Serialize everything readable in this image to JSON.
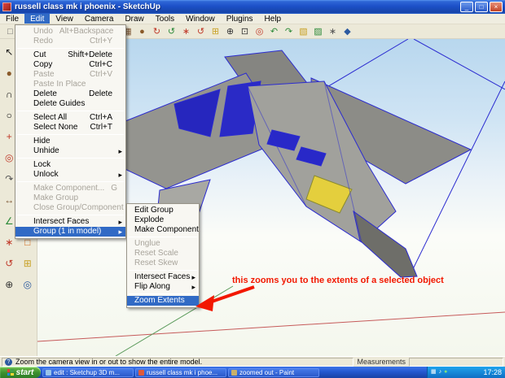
{
  "colors": {
    "accent": "#316AC5",
    "annotation_red": "#F21800",
    "selection_blue": "#2B2BD0",
    "canopy_yellow": "#E4CF3D",
    "axis_red": "#C65A5A",
    "axis_green": "#5A9A5A",
    "taskbar_blue": "#2458D0",
    "start_green": "#3B8F2E"
  },
  "window": {
    "title": "russell class mk i phoenix - SketchUp",
    "controls": [
      {
        "name": "minimize-button",
        "glyph": "_"
      },
      {
        "name": "maximize-button",
        "glyph": "□"
      },
      {
        "name": "close-button",
        "glyph": "×",
        "cls": "close"
      }
    ]
  },
  "menu_bar": {
    "items": [
      {
        "label": "File"
      },
      {
        "label": "Edit",
        "active": true
      },
      {
        "label": "View"
      },
      {
        "label": "Camera"
      },
      {
        "label": "Draw"
      },
      {
        "label": "Tools"
      },
      {
        "label": "Window"
      },
      {
        "label": "Plugins"
      },
      {
        "label": "Help"
      }
    ]
  },
  "top_toolbar": {
    "icons": [
      {
        "name": "new-icon",
        "glyph": "□",
        "color": "#666666"
      },
      {
        "name": "open-icon",
        "glyph": "▤",
        "color": "#C9A227"
      },
      {
        "name": "save-icon",
        "glyph": "▣",
        "color": "#2C5AA0"
      },
      {
        "name": "cut-icon",
        "glyph": "×",
        "color": "#555555"
      },
      {
        "name": "copy-icon",
        "glyph": "▥",
        "color": "#555555"
      },
      {
        "name": "paste-icon",
        "glyph": "▧",
        "color": "#777777"
      },
      {
        "name": "undo-icon",
        "glyph": "↶",
        "color": "#2C5AA0"
      },
      {
        "name": "redo-icon",
        "glyph": "↷",
        "color": "#2C5AA0"
      },
      {
        "name": "make-component-icon",
        "glyph": "▦",
        "color": "#7A5230"
      },
      {
        "name": "paint-bucket-icon",
        "glyph": "●",
        "color": "#8A5A2A"
      },
      {
        "name": "rotate-cw-icon",
        "glyph": "↻",
        "color": "#C03A2A"
      },
      {
        "name": "rotate-ccw-icon",
        "glyph": "↺",
        "color": "#2E8B3A"
      },
      {
        "name": "axes-tool-icon",
        "glyph": "∗",
        "color": "#C03A2A"
      },
      {
        "name": "orbit-icon",
        "glyph": "↺",
        "color": "#C03A2A"
      },
      {
        "name": "pan-icon",
        "glyph": "⊞",
        "color": "#C9A227"
      },
      {
        "name": "zoom-icon",
        "glyph": "⊕",
        "color": "#333333"
      },
      {
        "name": "zoom-window-icon",
        "glyph": "⊡",
        "color": "#333333"
      },
      {
        "name": "zoom-extents-icon",
        "glyph": "◎",
        "color": "#C03A2A"
      },
      {
        "name": "previous-view-icon",
        "glyph": "↶",
        "color": "#2E8B3A"
      },
      {
        "name": "next-view-icon",
        "glyph": "↷",
        "color": "#2E8B3A"
      },
      {
        "name": "plugin-box-icon",
        "glyph": "▧",
        "color": "#C9A227"
      },
      {
        "name": "plugin-box2-icon",
        "glyph": "▨",
        "color": "#2E8B3A"
      },
      {
        "name": "plugin-gear-icon",
        "glyph": "∗",
        "color": "#555555"
      },
      {
        "name": "plugin-diamond-icon",
        "glyph": "◆",
        "color": "#2C5AA0"
      }
    ]
  },
  "left_toolbar": {
    "icons": [
      {
        "name": "select-icon",
        "glyph": "↖",
        "color": "#111111"
      },
      {
        "name": "eraser-icon",
        "glyph": "▬",
        "color": "#B0568A"
      },
      {
        "name": "paint-icon",
        "glyph": "●",
        "color": "#8A5A2A"
      },
      {
        "name": "line-icon",
        "glyph": "/",
        "color": "#111111"
      },
      {
        "name": "arc-icon",
        "glyph": "∩",
        "color": "#111111"
      },
      {
        "name": "rectangle-icon",
        "glyph": "□",
        "color": "#111111"
      },
      {
        "name": "circle-icon",
        "glyph": "○",
        "color": "#111111"
      },
      {
        "name": "polygon-icon",
        "glyph": "◇",
        "color": "#111111"
      },
      {
        "name": "move-icon",
        "glyph": "+",
        "color": "#C03A2A"
      },
      {
        "name": "rotate-icon",
        "glyph": "↻",
        "color": "#2C5AA0"
      },
      {
        "name": "offset-icon",
        "glyph": "◎",
        "color": "#C03A2A"
      },
      {
        "name": "push-pull-icon",
        "glyph": "↑",
        "color": "#7A5230"
      },
      {
        "name": "follow-me-icon",
        "glyph": "↷",
        "color": "#555555"
      },
      {
        "name": "scale-icon",
        "glyph": "▣",
        "color": "#C9A227"
      },
      {
        "name": "tape-measure-icon",
        "glyph": "↔",
        "color": "#7A5230"
      },
      {
        "name": "dimension-icon",
        "glyph": "⊢",
        "color": "#333333"
      },
      {
        "name": "protractor-icon",
        "glyph": "∠",
        "color": "#2E8B3A"
      },
      {
        "name": "text-icon",
        "glyph": "A",
        "color": "#111111"
      },
      {
        "name": "axes-icon",
        "glyph": "∗",
        "color": "#C03A2A"
      },
      {
        "name": "section-plane-icon",
        "glyph": "□",
        "color": "#D2691E"
      },
      {
        "name": "orbit-icon",
        "glyph": "↺",
        "color": "#C03A2A"
      },
      {
        "name": "pan-icon",
        "glyph": "⊞",
        "color": "#C9A227"
      },
      {
        "name": "zoom-icon",
        "glyph": "⊕",
        "color": "#333333"
      },
      {
        "name": "zoom-extents-icon",
        "glyph": "◎",
        "color": "#2C5AA0"
      }
    ]
  },
  "edit_menu": {
    "items": [
      {
        "label": "Undo",
        "shortcut": "Alt+Backspace",
        "disabled": true
      },
      {
        "label": "Redo",
        "shortcut": "Ctrl+Y",
        "disabled": true
      },
      {
        "separator": true
      },
      {
        "label": "Cut",
        "shortcut": "Shift+Delete"
      },
      {
        "label": "Copy",
        "shortcut": "Ctrl+C"
      },
      {
        "label": "Paste",
        "shortcut": "Ctrl+V",
        "disabled": true
      },
      {
        "label": "Paste In Place",
        "disabled": true
      },
      {
        "label": "Delete",
        "shortcut": "Delete"
      },
      {
        "label": "Delete Guides"
      },
      {
        "separator": true
      },
      {
        "label": "Select All",
        "shortcut": "Ctrl+A"
      },
      {
        "label": "Select None",
        "shortcut": "Ctrl+T"
      },
      {
        "separator": true
      },
      {
        "label": "Hide"
      },
      {
        "label": "Unhide",
        "submenu": true
      },
      {
        "separator": true
      },
      {
        "label": "Lock"
      },
      {
        "label": "Unlock",
        "submenu": true
      },
      {
        "separator": true
      },
      {
        "label": "Make Component...",
        "shortcut": "G",
        "disabled": true
      },
      {
        "label": "Make Group",
        "disabled": true
      },
      {
        "label": "Close Group/Component",
        "disabled": true
      },
      {
        "separator": true
      },
      {
        "label": "Intersect Faces",
        "submenu": true
      },
      {
        "label": "Group (1 in model)",
        "submenu": true,
        "highlight": true
      }
    ]
  },
  "group_submenu": {
    "items": [
      {
        "label": "Edit Group"
      },
      {
        "label": "Explode"
      },
      {
        "label": "Make Component"
      },
      {
        "separator": true
      },
      {
        "label": "Unglue",
        "disabled": true
      },
      {
        "label": "Reset Scale",
        "disabled": true
      },
      {
        "label": "Reset Skew",
        "disabled": true
      },
      {
        "separator": true
      },
      {
        "label": "Intersect Faces",
        "submenu": true
      },
      {
        "label": "Flip Along",
        "submenu": true
      },
      {
        "separator": true
      },
      {
        "label": "Zoom Extents",
        "highlight": true
      }
    ]
  },
  "annotation": {
    "text": "this zooms you to the extents of a selected object"
  },
  "status_bar": {
    "help_glyph": "?",
    "help_text": "Zoom the camera view in or out to show the entire model.",
    "measurements_label": "Measurements",
    "measurement_value": ""
  },
  "taskbar": {
    "start_label": "start",
    "tasks": [
      {
        "label": "edit : Sketchup 3D m...",
        "icon_color": "#9AC4EA"
      },
      {
        "label": "russell class mk i phoe...",
        "icon_color": "#E05A3A"
      },
      {
        "label": "zoomed out - Paint",
        "icon_color": "#C9B06A"
      }
    ],
    "tray_icons": [
      {
        "name": "network-icon",
        "glyph": "▦",
        "color": "#FFFFFF"
      },
      {
        "name": "volume-icon",
        "glyph": "♪",
        "color": "#FFFFFF"
      },
      {
        "name": "shield-icon",
        "glyph": "●",
        "color": "#7FE07F"
      }
    ],
    "time": "17:28"
  }
}
